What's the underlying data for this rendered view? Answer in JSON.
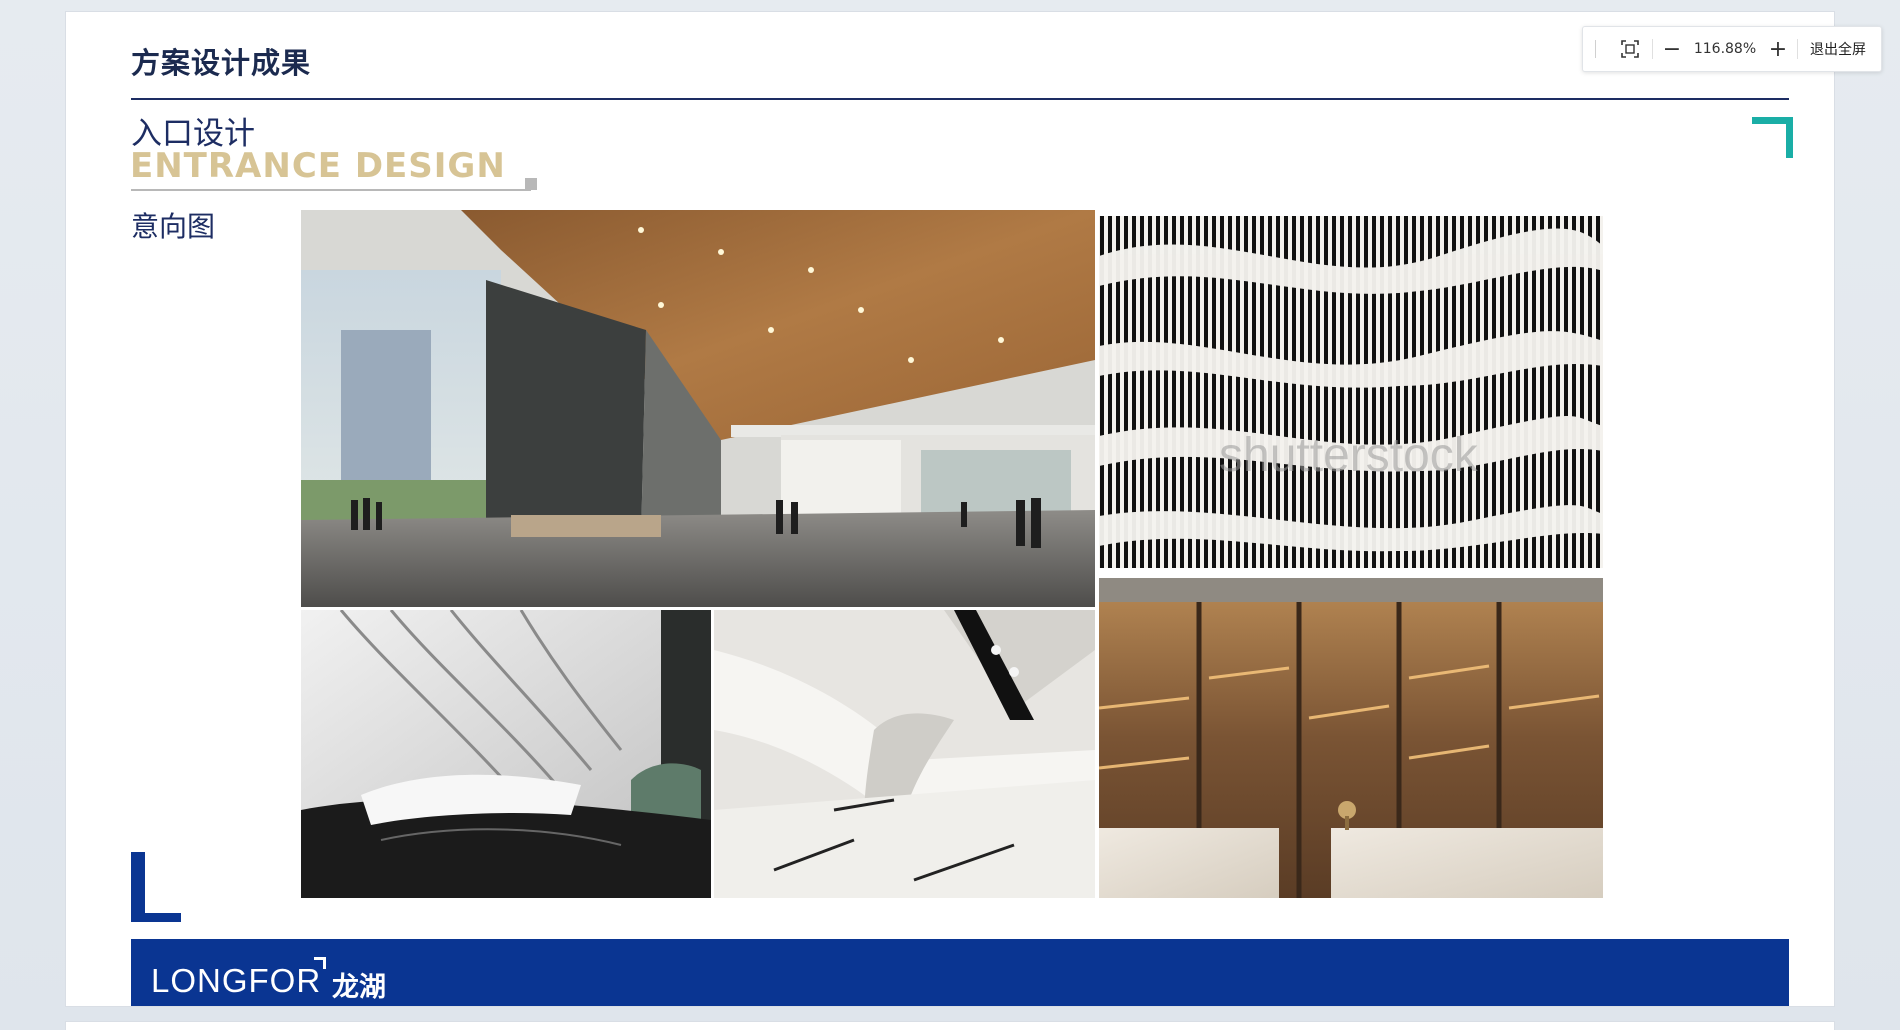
{
  "slide": {
    "title": "方案设计成果",
    "section_cn": "入口设计",
    "section_en": "ENTRANCE DESIGN",
    "label": "意向图",
    "logo_en": "LONGFOR",
    "logo_cn": "龙湖"
  },
  "photos": [
    {
      "name": "lobby-atrium-photo",
      "subject": "wood-ceiling entrance lobby with people"
    },
    {
      "name": "wave-slat-wall-photo",
      "subject": "black and white wavy slat wall",
      "watermark": "shutterstock"
    },
    {
      "name": "white-curved-lobby-photo",
      "subject": "white sculpted lobby with reception desk"
    },
    {
      "name": "white-ceiling-detail-photo",
      "subject": "curved white ceiling with downlights"
    },
    {
      "name": "bronze-panel-wall-photo",
      "subject": "bronze panel wall with marble counter"
    }
  ],
  "toolbar": {
    "zoom_level": "116.88%",
    "zoom_out_symbol": "−",
    "zoom_in_symbol": "+",
    "exit_fullscreen_label": "退出全屏"
  },
  "colors": {
    "navy": "#1d2d63",
    "brand_blue": "#0a3592",
    "gold": "#d7c495",
    "teal": "#1aaea6"
  }
}
